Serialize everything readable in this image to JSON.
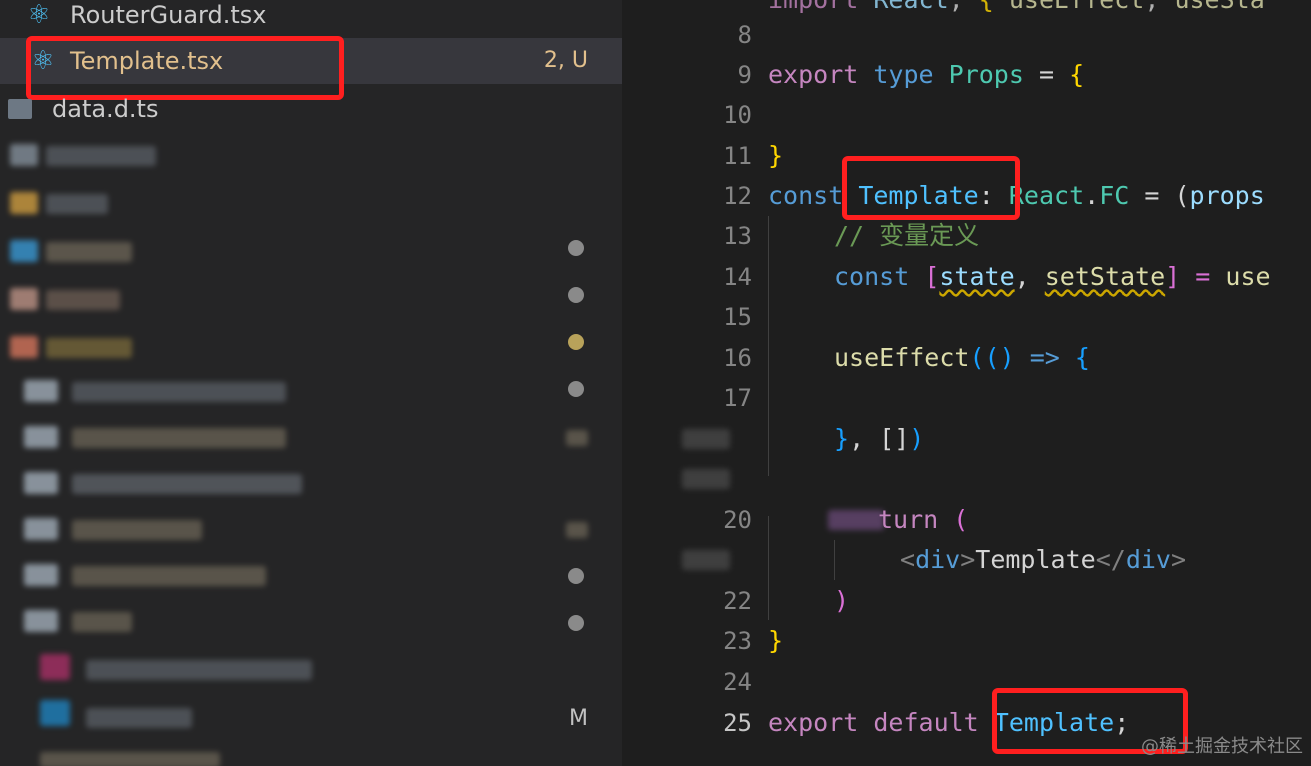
{
  "explorer": {
    "files": [
      {
        "name": "RouterGuard.tsx",
        "icon": "react-icon"
      },
      {
        "name": "Template.tsx",
        "icon": "react-icon",
        "status": "2, U"
      },
      {
        "name": "data.d.ts",
        "icon": "file-icon"
      }
    ],
    "blurred_badge_M": "M"
  },
  "editor": {
    "line_numbers": [
      "8",
      "9",
      "10",
      "11",
      "12",
      "13",
      "14",
      "15",
      "16",
      "17",
      "20",
      "22",
      "23",
      "24",
      "25"
    ],
    "code": {
      "l9_export": "export",
      "l9_type": "type",
      "l9_props": "Props",
      "l9_eq": " = ",
      "l9_brace": "{",
      "l11_brace": "}",
      "l12_const": "const",
      "l12_template": "Template",
      "l12_colon": ": ",
      "l12_react": "React",
      "l12_dot": ".",
      "l12_fc": "FC",
      "l12_eq": " = (",
      "l12_props": "props",
      "l13_comment": "// 变量定义",
      "l14_const": "const",
      "l14_open": " [",
      "l14_state": "state",
      "l14_comma": ", ",
      "l14_setstate": "setState",
      "l14_close": "] = ",
      "l14_use": "use",
      "l16_useeffect": "useEffect",
      "l16_open": "((",
      "l16_close": ") ",
      "l16_arrow": "=>",
      "l16_brace": " {",
      "l18_close": "}",
      "l18_arr": ", []",
      "l18_paren": ")",
      "l20_return": "turn",
      "l20_paren": " (",
      "l21_open_lt": "<",
      "l21_div": "div",
      "l21_gt": ">",
      "l21_text": "Template",
      "l21_close_lt": "</",
      "l21_div2": "div",
      "l21_gt2": ">",
      "l22_paren": ")",
      "l23_brace": "}",
      "l25_export": "export",
      "l25_default": "default",
      "l25_template": "Template",
      "l25_semi": ";"
    }
  },
  "watermark": "@稀土掘金技术社区"
}
